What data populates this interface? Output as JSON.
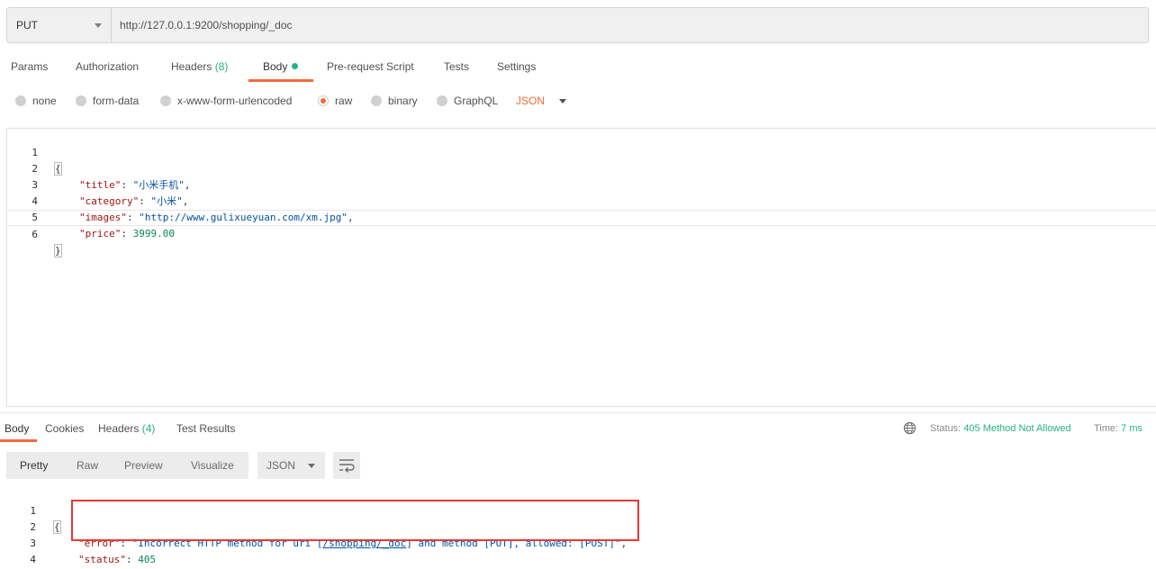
{
  "request": {
    "method": "PUT",
    "url": "http://127.0.0.1:9200/shopping/_doc"
  },
  "request_tabs": [
    {
      "label": "Params"
    },
    {
      "label": "Authorization"
    },
    {
      "label": "Headers",
      "count": "(8)"
    },
    {
      "label": "Body",
      "active": true
    },
    {
      "label": "Pre-request Script"
    },
    {
      "label": "Tests"
    },
    {
      "label": "Settings"
    }
  ],
  "body_types": {
    "options": [
      "none",
      "form-data",
      "x-www-form-urlencoded",
      "raw",
      "binary",
      "GraphQL"
    ],
    "selected": "raw",
    "format": "JSON"
  },
  "request_body": {
    "line_numbers": [
      "1",
      "2",
      "3",
      "4",
      "5",
      "6"
    ],
    "open_brace": "{",
    "close_brace": "}",
    "fields": [
      {
        "key": "\"title\"",
        "sep": ": ",
        "value": "\"小米手机\"",
        "tail": ",",
        "type": "string"
      },
      {
        "key": "\"category\"",
        "sep": ": ",
        "value": "\"小米\"",
        "tail": ",",
        "type": "string"
      },
      {
        "key": "\"images\"",
        "sep": ": ",
        "value": "\"http://www.gulixueyuan.com/xm.jpg\"",
        "tail": ",",
        "type": "string"
      },
      {
        "key": "\"price\"",
        "sep": ": ",
        "value": "3999.00",
        "tail": "",
        "type": "number"
      }
    ]
  },
  "response_tabs": [
    {
      "label": "Body",
      "active": true
    },
    {
      "label": "Cookies"
    },
    {
      "label": "Headers",
      "count": "(4)"
    },
    {
      "label": "Test Results"
    }
  ],
  "response_meta": {
    "status_label": "Status:",
    "status_value": "405 Method Not Allowed",
    "time_label": "Time:",
    "time_value": "7 ms"
  },
  "response_views": [
    "Pretty",
    "Raw",
    "Preview",
    "Visualize"
  ],
  "response_format": "JSON",
  "response_body": {
    "line_numbers": [
      "1",
      "2",
      "3",
      "4"
    ],
    "open_brace": "{",
    "close_brace": "}",
    "error_key": "\"error\"",
    "error_value_pre": "\"Incorrect HTTP method for uri [",
    "error_value_uri": "/shopping/_doc",
    "error_value_post": "] and method [PUT], allowed: [POST]\"",
    "status_key": "\"status\"",
    "status_value": "405"
  },
  "colors": {
    "accent": "#f26b3a",
    "success": "#26b47f",
    "highlight_box": "#e53935"
  }
}
